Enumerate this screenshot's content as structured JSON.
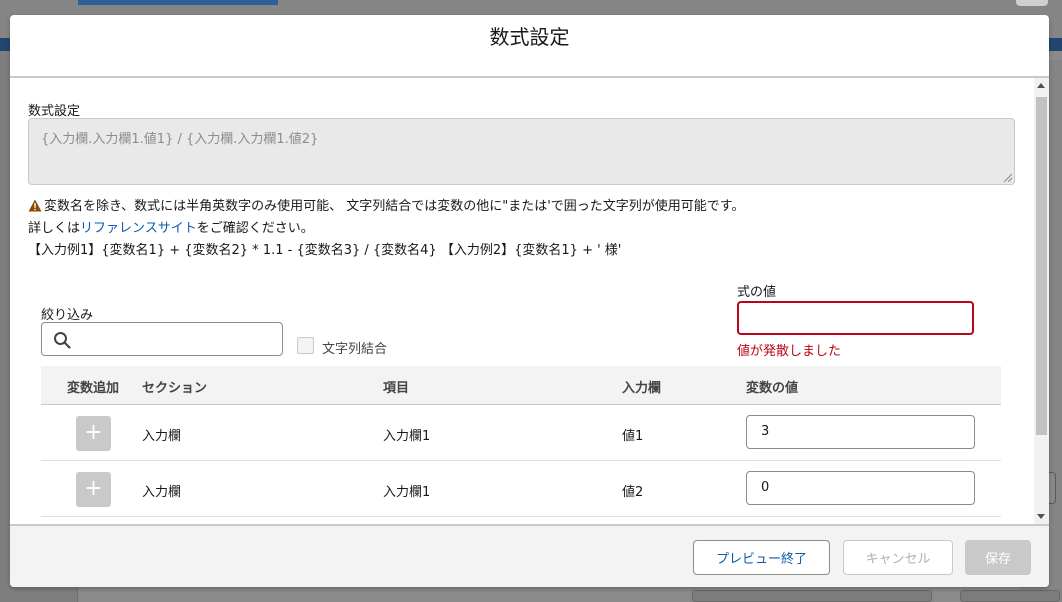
{
  "modal": {
    "title": "数式設定"
  },
  "formula": {
    "label": "数式設定",
    "value": "{入力欄.入力欄1.値1} / {入力欄.入力欄1.値2}"
  },
  "info": {
    "warning_text": "変数名を除き、数式には半角英数字のみ使用可能、 文字列結合では変数の他に\"または'で囲った文字列が使用可能です。",
    "detail_prefix": "詳しくは",
    "reference_link": "リファレンスサイト",
    "detail_suffix": "をご確認ください。",
    "examples": "【入力例1】{変数名1} + {変数名2} * 1.1 - {変数名3} / {変数名4} 【入力例2】{変数名1} + ' 様'"
  },
  "filter": {
    "label": "絞り込み",
    "value": ""
  },
  "concat": {
    "label": "文字列結合",
    "checked": false
  },
  "formula_value": {
    "label": "式の値",
    "value": "",
    "error": "値が発散しました"
  },
  "table": {
    "headers": [
      "変数追加",
      "セクション",
      "項目",
      "入力欄",
      "変数の値"
    ],
    "rows": [
      {
        "add": "+",
        "section": "入力欄",
        "item": "入力欄1",
        "field": "値1",
        "value": "3"
      },
      {
        "add": "+",
        "section": "入力欄",
        "item": "入力欄1",
        "field": "値2",
        "value": "0"
      }
    ]
  },
  "footer": {
    "preview_end": "プレビュー終了",
    "cancel": "キャンセル",
    "save": "保存"
  },
  "colors": {
    "link": "#0b5cab",
    "error": "#ba0517",
    "disabled": "#c9c9c9"
  }
}
